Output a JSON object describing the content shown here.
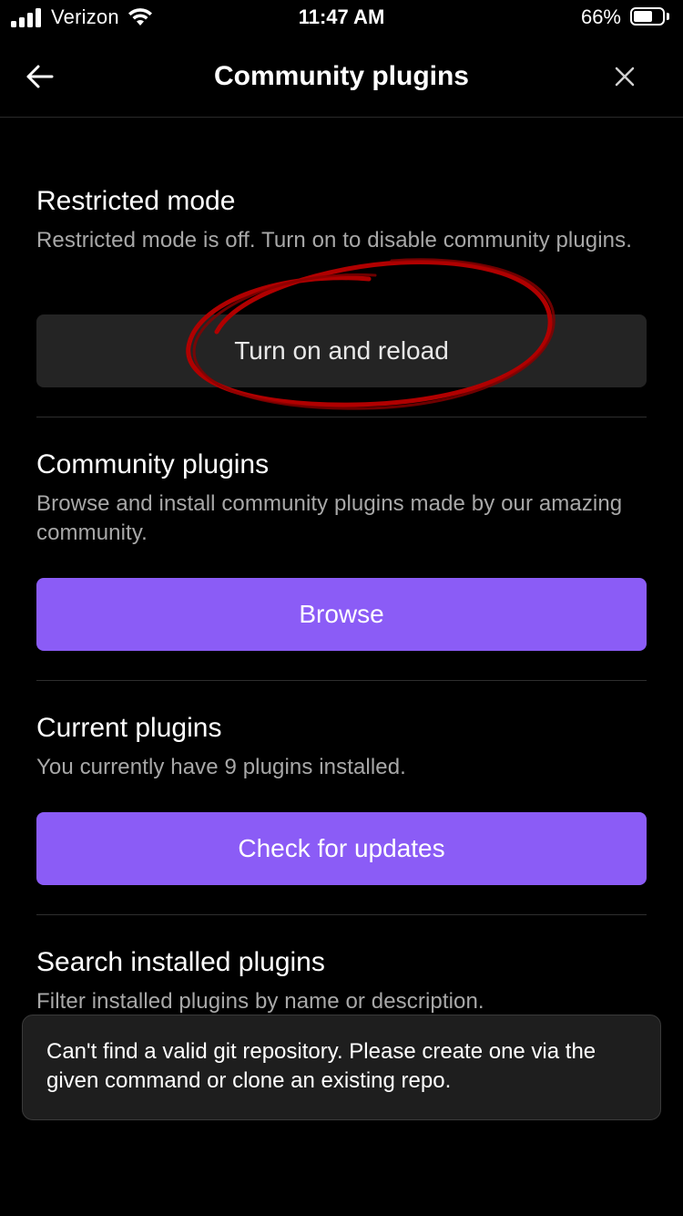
{
  "status_bar": {
    "carrier": "Verizon",
    "time": "11:47 AM",
    "battery_percent_label": "66%",
    "battery_level": 0.66
  },
  "nav": {
    "title": "Community plugins",
    "back_icon": "back-arrow-icon",
    "close_icon": "close-icon"
  },
  "restricted": {
    "title": "Restricted mode",
    "description": "Restricted mode is off. Turn on to disable community plugins.",
    "button_label": "Turn on and reload"
  },
  "community": {
    "title": "Community plugins",
    "description": "Browse and install community plugins made by our amazing community.",
    "button_label": "Browse"
  },
  "current": {
    "title": "Current plugins",
    "description": "You currently have 9 plugins installed.",
    "button_label": "Check for updates"
  },
  "search": {
    "title": "Search installed plugins",
    "description": "Filter installed plugins by name or description."
  },
  "toast": {
    "message": "Can't find a valid git repository. Please create one via the given command or clone an existing repo."
  },
  "colors": {
    "background": "#000000",
    "accent": "#8b5cf6",
    "secondary_button": "#242424",
    "muted_text": "#a8a8a8",
    "annotation": "#b00000"
  }
}
